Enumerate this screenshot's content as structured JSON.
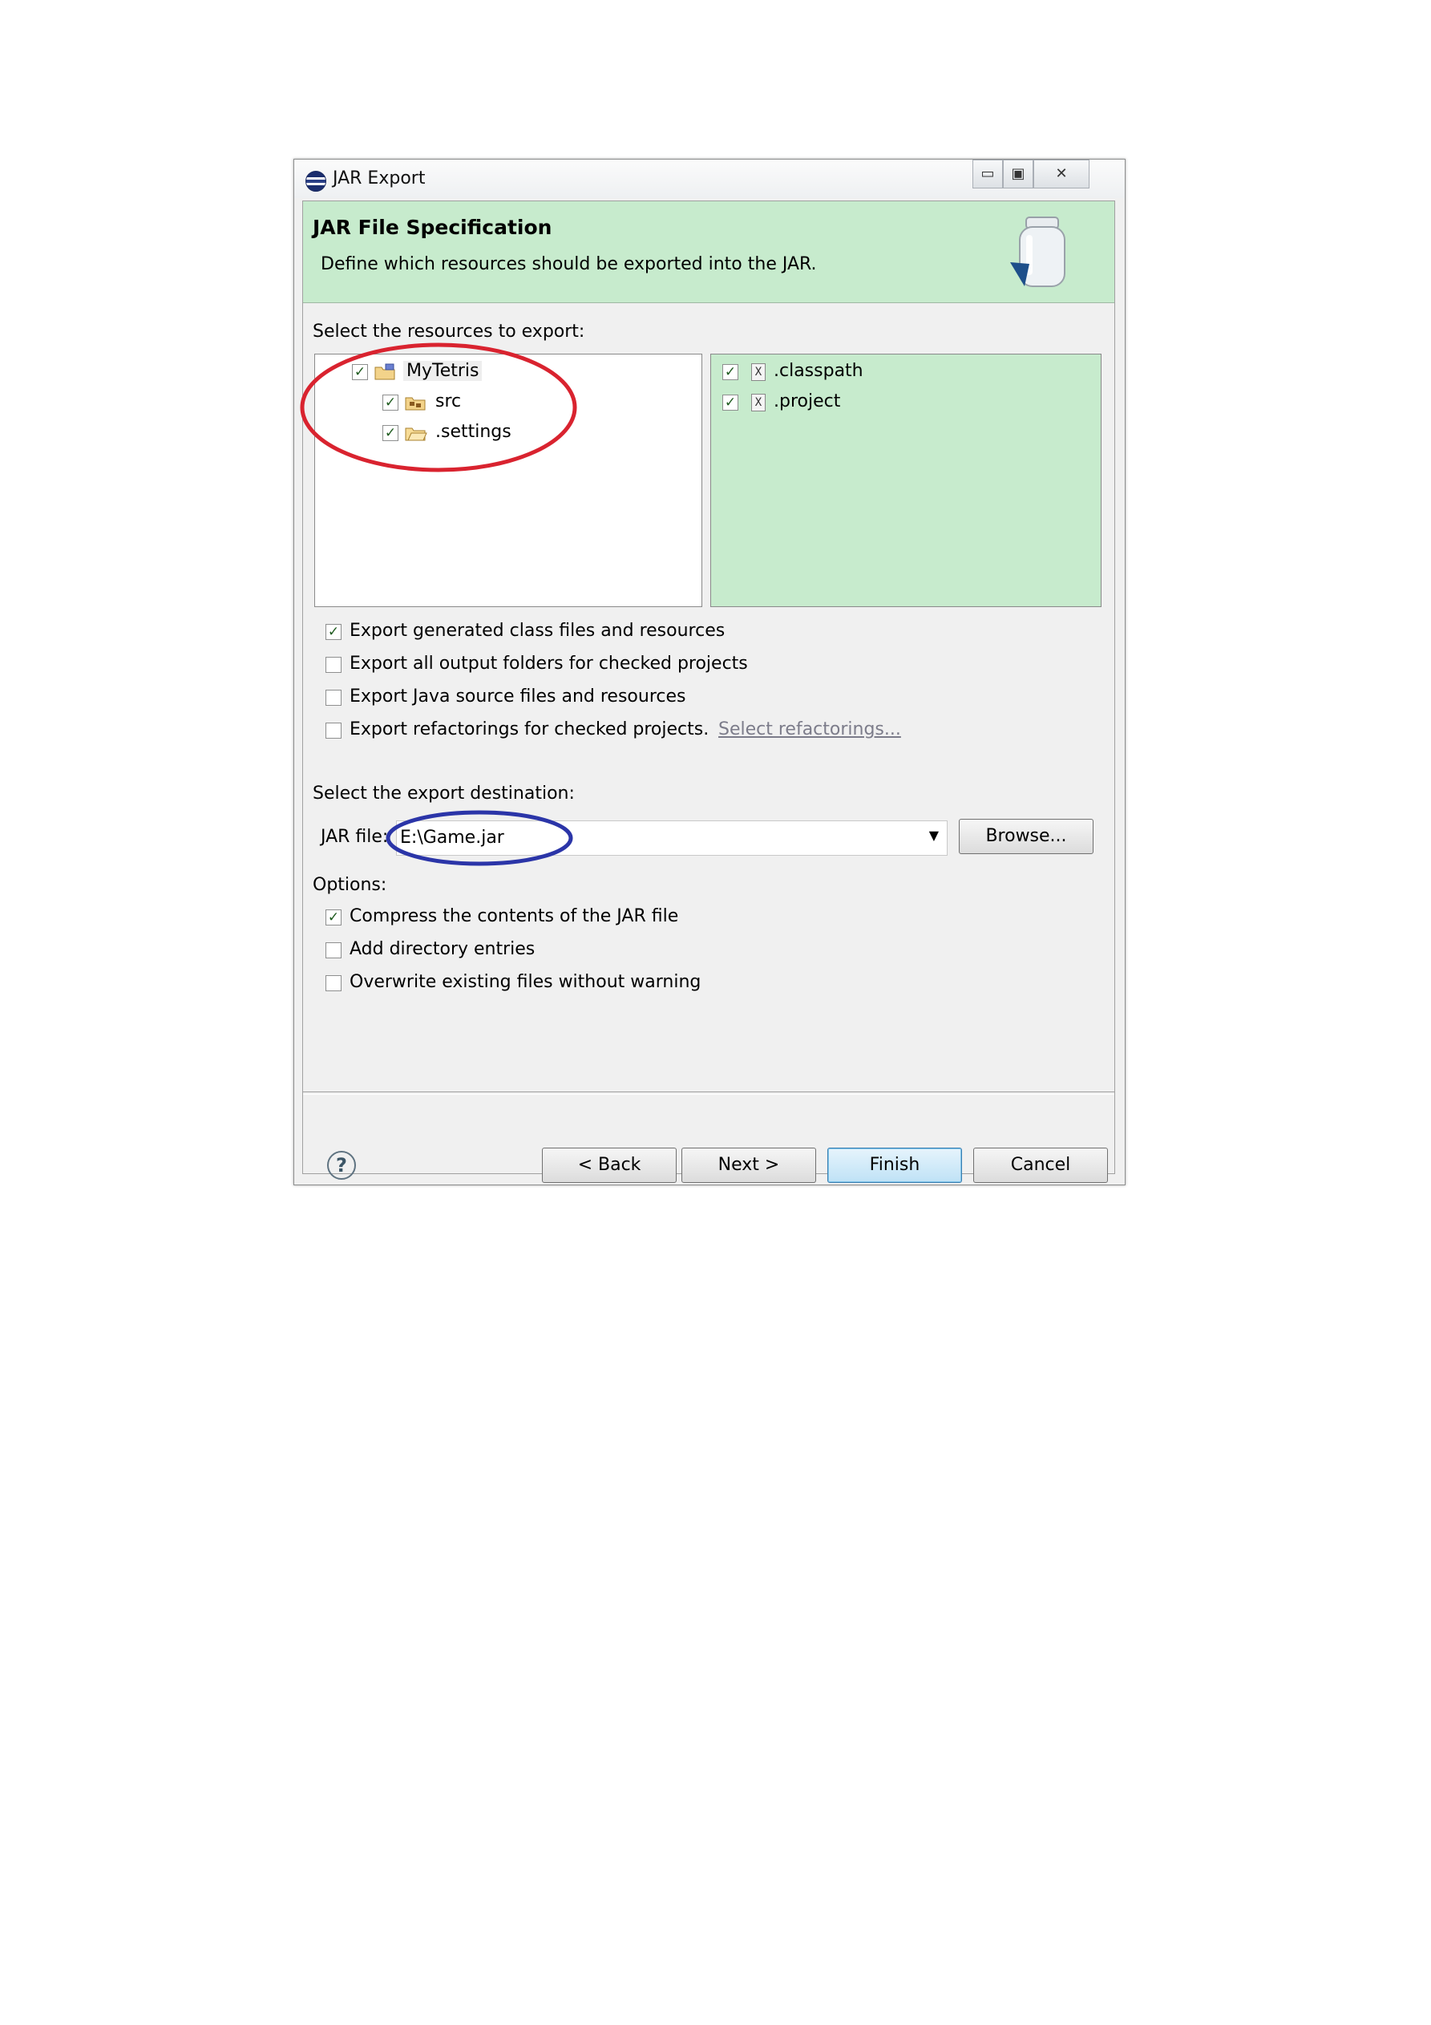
{
  "window": {
    "title": "JAR Export",
    "minimize_label": "▭",
    "maximize_label": "▣",
    "close_label": "✕"
  },
  "banner": {
    "title": "JAR File Specification",
    "description": "Define which resources should be exported into the JAR."
  },
  "resources": {
    "label": "Select the resources to export:",
    "tree": [
      {
        "label": "MyTetris",
        "checked": true,
        "icon": "project-folder-icon"
      },
      {
        "label": "src",
        "checked": true,
        "icon": "package-folder-icon"
      },
      {
        "label": ".settings",
        "checked": true,
        "icon": "folder-icon"
      }
    ],
    "files": [
      {
        "label": ".classpath",
        "checked": true,
        "icon": "xml-file-icon"
      },
      {
        "label": ".project",
        "checked": true,
        "icon": "xml-file-icon"
      }
    ]
  },
  "export_options": {
    "generated_class_files": {
      "label": "Export generated class files and resources",
      "checked": true
    },
    "all_output_folders": {
      "label": "Export all output folders for checked projects",
      "checked": false
    },
    "java_source_files": {
      "label": "Export Java source files and resources",
      "checked": false
    },
    "refactorings": {
      "label": "Export refactorings for checked projects.",
      "checked": false
    },
    "select_refactorings_link": "Select refactorings..."
  },
  "destination": {
    "label": "Select the export destination:",
    "jar_file_label": "JAR file:",
    "jar_file_value": "E:\\Game.jar",
    "browse_label": "Browse..."
  },
  "options": {
    "label": "Options:",
    "compress": {
      "label": "Compress the contents of the JAR file",
      "checked": true
    },
    "directory_entries": {
      "label": "Add directory entries",
      "checked": false
    },
    "overwrite": {
      "label": "Overwrite existing files without warning",
      "checked": false
    }
  },
  "footer": {
    "help_label": "?",
    "back_label": "< Back",
    "next_label": "Next >",
    "finish_label": "Finish",
    "cancel_label": "Cancel"
  },
  "annotations": {
    "red_ellipse_color": "#d9232f",
    "blue_ellipse_color": "#2b35a8"
  }
}
